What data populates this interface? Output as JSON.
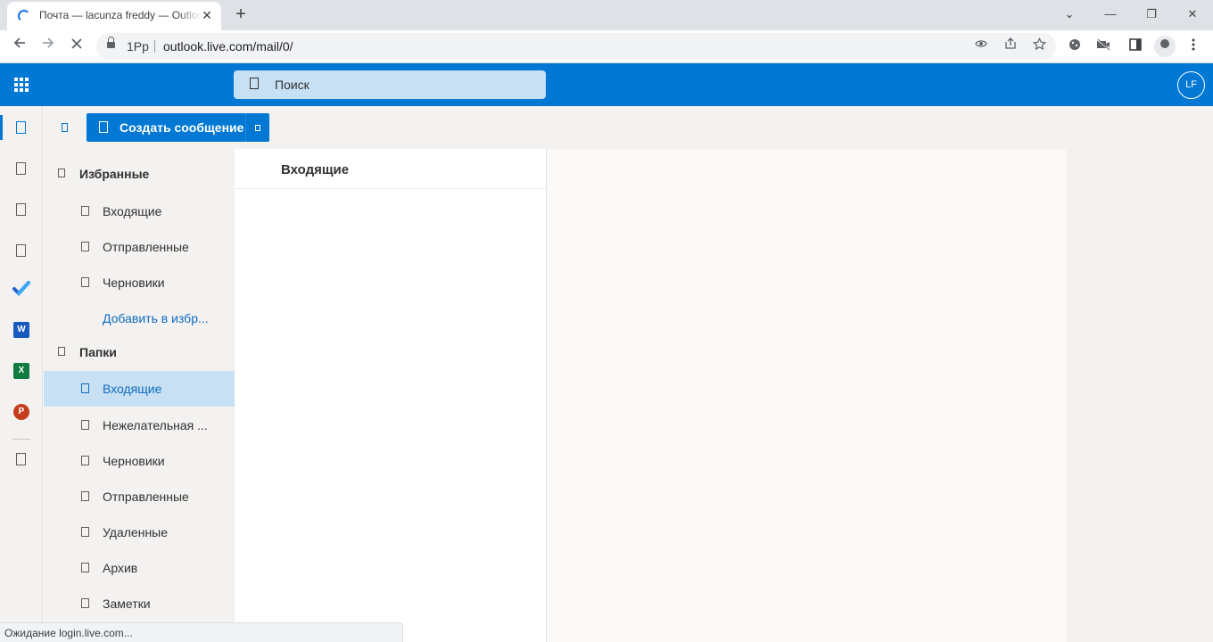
{
  "browser": {
    "tab_title": "Почта — lacunza freddy — Outlook",
    "new_tab_label": "+",
    "window_controls": {
      "minimize": "—",
      "restore": "❐",
      "close": "✕",
      "tabsearch": "⌄"
    },
    "page_info_badge": "1Pp",
    "url": "outlook.live.com/mail/0/",
    "status_text": "Ожидание login.live.com..."
  },
  "icons": {
    "back": "arrow-left-icon",
    "forward": "arrow-right-icon",
    "stop": "stop-loading-icon",
    "lock": "lock-icon",
    "eye": "eye-icon",
    "share": "share-icon",
    "star": "star-icon",
    "extensions": [
      "cookie-icon",
      "video-off-icon",
      "side-panel-icon"
    ],
    "menu": "more-vert-icon"
  },
  "outlook": {
    "search_placeholder": "Поиск",
    "avatar_initials": "LF",
    "new_message_label": "Создать сообщение",
    "accent_color": "#0078d4",
    "rail_apps": [
      {
        "name": "mail",
        "label": ""
      },
      {
        "name": "calendar",
        "label": ""
      },
      {
        "name": "people",
        "label": ""
      },
      {
        "name": "attach",
        "label": ""
      },
      {
        "name": "todo",
        "label": ""
      },
      {
        "name": "word",
        "label": "W",
        "color": "#185abd"
      },
      {
        "name": "excel",
        "label": "X",
        "color": "#107c41"
      },
      {
        "name": "powerpoint",
        "label": "P",
        "color": "#c43e1c"
      },
      {
        "name": "more-apps",
        "label": ""
      }
    ],
    "favorites": {
      "header": "Избранные",
      "items": [
        "Входящие",
        "Отправленные",
        "Черновики"
      ],
      "add_link": "Добавить в избр..."
    },
    "folders": {
      "header": "Папки",
      "items": [
        "Входящие",
        "Нежелательная ...",
        "Черновики",
        "Отправленные",
        "Удаленные",
        "Архив",
        "Заметки"
      ],
      "selected_index": 0
    },
    "message_list_title": "Входящие"
  }
}
